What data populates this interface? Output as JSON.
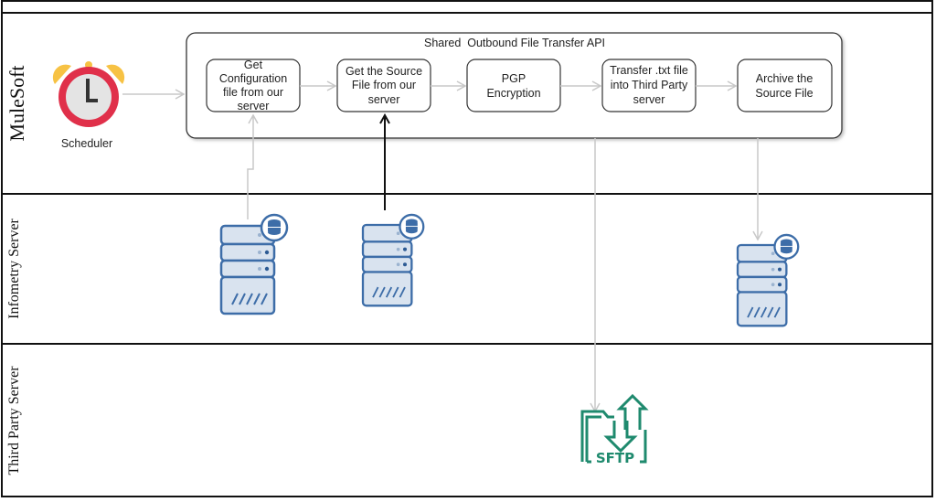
{
  "lanes": [
    {
      "label": "MuleSoft"
    },
    {
      "label": "Infometry Server"
    },
    {
      "label": "Third Party Server"
    }
  ],
  "scheduler": {
    "label": "Scheduler",
    "icon": "alarm-clock-icon"
  },
  "container": {
    "title": "Shared  Outbound File Transfer API"
  },
  "steps": [
    {
      "lines": [
        "Get",
        "Configuration",
        "file from our",
        "server"
      ]
    },
    {
      "lines": [
        "Get the Source",
        "File  from our",
        "server"
      ]
    },
    {
      "lines": [
        "PGP",
        "Encryption"
      ]
    },
    {
      "lines": [
        "Transfer .txt file",
        "into Third Party",
        "server"
      ]
    },
    {
      "lines": [
        "Archive the",
        "Source File"
      ]
    }
  ],
  "sftp": {
    "label": "SFTP",
    "icon": "sftp-icon"
  },
  "colors": {
    "clock_ring": "#e0304a",
    "clock_bells": "#f7c244",
    "server_fill": "#d9e3ef",
    "server_stroke": "#3d6da8",
    "sftp": "#1f8a6e",
    "arrow_gray": "#c8c8c8"
  }
}
